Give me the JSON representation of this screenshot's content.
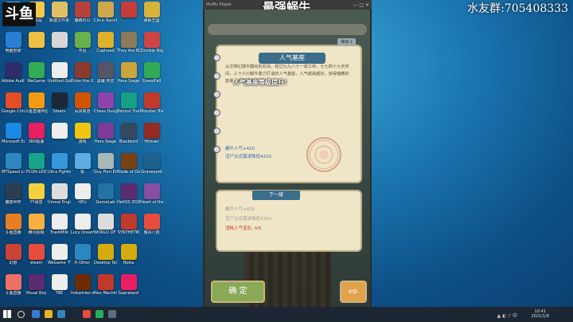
{
  "stream": {
    "logo": "斗鱼",
    "qq_group": "水友群:705408333"
  },
  "desktop_icons": [
    {
      "label": "回收站",
      "color": "#7bb0d8"
    },
    {
      "label": "回收站",
      "color": "#f2c84b"
    },
    {
      "label": "新建文件夹",
      "color": "#e0c067"
    },
    {
      "label": "撒森石公",
      "color": "#b5413a"
    },
    {
      "label": "Clinic Rancher",
      "color": "#cfa84c"
    },
    {
      "label": "",
      "color": "#c83b3b"
    },
    {
      "label": "弹射王国",
      "color": "#d9b23a"
    },
    {
      "label": "电脑管家",
      "color": "#2a7fd4"
    },
    {
      "label": "",
      "color": "#f0c040"
    },
    {
      "label": "",
      "color": "#d6d6d6"
    },
    {
      "label": "平台",
      "color": "#6ab04c"
    },
    {
      "label": "Cuphead",
      "color": "#e1b12c"
    },
    {
      "label": "They Are Billions",
      "color": "#8c7a5b"
    },
    {
      "label": "Zombie Night",
      "color": "#c44"
    },
    {
      "label": "Adobe Audition",
      "color": "#2d2d6a"
    },
    {
      "label": "WeGame",
      "color": "#33aa55"
    },
    {
      "label": "Untitled Goose",
      "color": "#eee"
    },
    {
      "label": "Enter the Gungeon",
      "color": "#8a3b2b"
    },
    {
      "label": "黑蛾 怀念",
      "color": "#556"
    },
    {
      "label": "Hero Siege",
      "color": "#c9a53c"
    },
    {
      "label": "GreedFall",
      "color": "#3a5"
    },
    {
      "label": "Google Chrome",
      "color": "#e44d26"
    },
    {
      "label": "斗鱼直播伴侣",
      "color": "#f39c12"
    },
    {
      "label": "Steam",
      "color": "#1b2838"
    },
    {
      "label": "百货商店",
      "color": "#d35400"
    },
    {
      "label": "Chess Dungeons",
      "color": "#8e44ad"
    },
    {
      "label": "Behind The Screen",
      "color": "#16a085"
    },
    {
      "label": "Monster Train",
      "color": "#c0392b"
    },
    {
      "label": "Microsoft Edge",
      "color": "#1e88e5"
    },
    {
      "label": "360极速",
      "color": "#e91e63"
    },
    {
      "label": "",
      "color": "#eee"
    },
    {
      "label": "游戏",
      "color": "#f1c40f"
    },
    {
      "label": "Hero Siege",
      "color": "#7d3c98"
    },
    {
      "label": "Blackbird",
      "color": "#34495e"
    },
    {
      "label": "Hitman",
      "color": "#922b21"
    },
    {
      "label": "MTSpeed Lite",
      "color": "#2e86c1"
    },
    {
      "label": "PCDN LED",
      "color": "#17a589"
    },
    {
      "label": "Ultra Fighter",
      "color": "#3498db"
    },
    {
      "label": "极",
      "color": "#5dade2"
    },
    {
      "label": "Guy Fieri Emulation",
      "color": "#aab7b8"
    },
    {
      "label": "Blade of Darkness",
      "color": "#784212"
    },
    {
      "label": "Graveyard",
      "color": "#1f618d"
    },
    {
      "label": "魔兽世界",
      "color": "#2c3e50"
    },
    {
      "label": "YY语音",
      "color": "#f4d03f"
    },
    {
      "label": "Unreal Engine",
      "color": "#ddd"
    },
    {
      "label": "HEU",
      "color": "#eee"
    },
    {
      "label": "GameLab",
      "color": "#2471a3"
    },
    {
      "label": "HeliOS ZOO",
      "color": "#5b2c6f"
    },
    {
      "label": "Heart of the Imperial",
      "color": "#884ea0"
    },
    {
      "label": "斗鱼直播",
      "color": "#e67e22"
    },
    {
      "label": "腾讯视频",
      "color": "#f5b041"
    },
    {
      "label": "TrashMilk",
      "color": "#eee"
    },
    {
      "label": "Lucy Dreaming",
      "color": "#eee"
    },
    {
      "label": "WORLD OF HORROR",
      "color": "#ddd"
    },
    {
      "label": "SYNTHETIK",
      "color": "#c0392b"
    },
    {
      "label": "鬼谷八荒",
      "color": "#e74c3c"
    },
    {
      "label": "幻塔",
      "color": "#cb4335"
    },
    {
      "label": "steam",
      "color": "#e74c3c"
    },
    {
      "label": "WeGame 下载",
      "color": "#eee"
    },
    {
      "label": "H Other",
      "color": "#2e86c1"
    },
    {
      "label": "Desktop Tales",
      "color": "#d4ac0d"
    },
    {
      "label": "Noita",
      "color": "#d4ac0d"
    },
    {
      "label": "",
      "color": "transparent"
    },
    {
      "label": "斗鱼直播",
      "color": "#ec7063"
    },
    {
      "label": "Visual Boy",
      "color": "#5b2c6f"
    },
    {
      "label": "TBE",
      "color": "#eee"
    },
    {
      "label": "Industries of Titan",
      "color": "#6e2c00"
    },
    {
      "label": "Neo Machine",
      "color": "#c0392b"
    },
    {
      "label": "Supraland",
      "color": "#e91e63"
    },
    {
      "label": "",
      "color": "transparent"
    }
  ],
  "emulator": {
    "app_name": "MuMu Player",
    "title": "最强蜗牛",
    "controls": "— □ ✕"
  },
  "game": {
    "tab_label": "等级 2",
    "panel_title": "人气基座",
    "description": "从文明幻境中翻出的石块，经过九九八十一道工序，七七四十九天时间，三十六只蜗牛鼎力打造的人气基座，人气越高越好，获得蕴藏的能量，并引来宝石",
    "highlight": "人气基座等级提升！",
    "stat_popularity": "蜗牛人气+420",
    "stat_ritual": "活尸仪式需求降低4200",
    "next_label": "下一级",
    "next_popularity": "蜗牛人气+430",
    "next_ritual": "活尸仪式需求降低4300",
    "cost": "消耗人气宝石: 0/5",
    "confirm_button": "确 定",
    "arrow_button": "⇨"
  },
  "taskbar": {
    "time": "10:41",
    "date": "2021/1/8"
  }
}
